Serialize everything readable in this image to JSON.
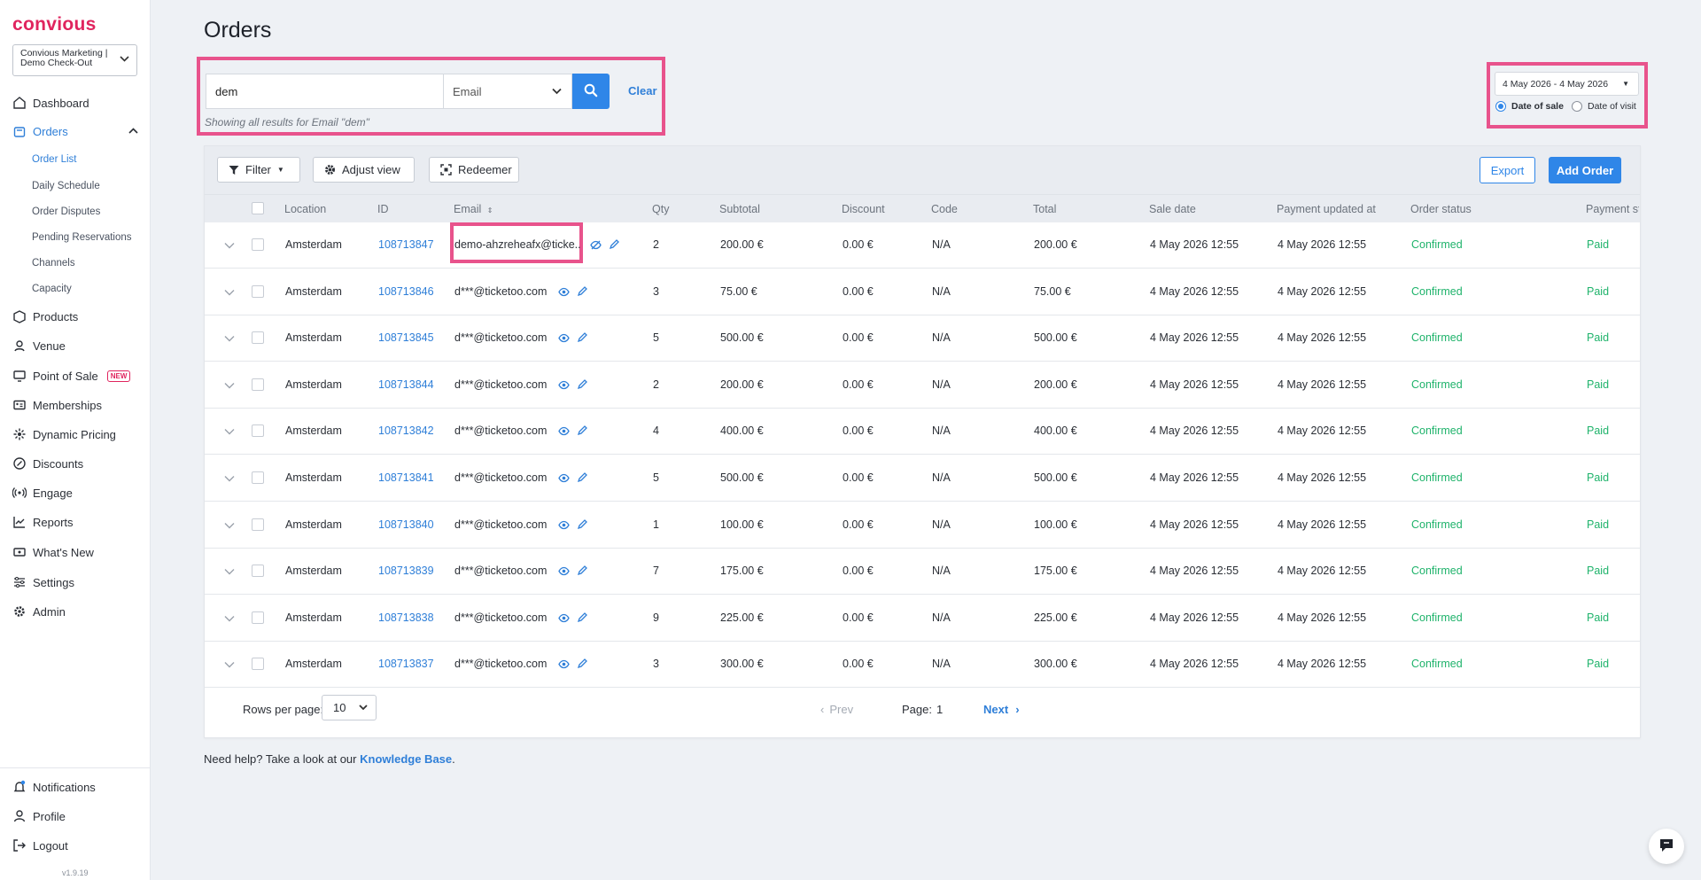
{
  "sidebar": {
    "logo": "convious",
    "account": {
      "line1": "Convious Marketing |",
      "line2": "Demo Check-Out"
    },
    "items": [
      {
        "label": "Dashboard",
        "icon": "home-icon"
      },
      {
        "label": "Orders",
        "icon": "bag-icon"
      },
      {
        "label": "Products",
        "icon": "box-icon"
      },
      {
        "label": "Venue",
        "icon": "venue-icon"
      },
      {
        "label": "Point of Sale",
        "icon": "monitor-icon",
        "badge": "NEW"
      },
      {
        "label": "Memberships",
        "icon": "id-card-icon"
      },
      {
        "label": "Dynamic Pricing",
        "icon": "pricing-icon"
      },
      {
        "label": "Discounts",
        "icon": "discount-icon"
      },
      {
        "label": "Engage",
        "icon": "broadcast-icon"
      },
      {
        "label": "Reports",
        "icon": "chart-icon"
      },
      {
        "label": "What's New",
        "icon": "ticket-icon"
      },
      {
        "label": "Settings",
        "icon": "sliders-icon"
      },
      {
        "label": "Admin",
        "icon": "gear-icon"
      }
    ],
    "order_sub": [
      "Order List",
      "Daily Schedule",
      "Order Disputes",
      "Pending Reservations",
      "Channels",
      "Capacity"
    ],
    "bottom": [
      {
        "label": "Notifications",
        "icon": "bell-icon"
      },
      {
        "label": "Profile",
        "icon": "user-icon"
      },
      {
        "label": "Logout",
        "icon": "logout-icon"
      }
    ],
    "version": "v1.9.19"
  },
  "page": {
    "title": "Orders"
  },
  "search": {
    "value": "dem",
    "type": "Email",
    "clear": "Clear",
    "hint": "Showing all results for Email \"dem\""
  },
  "date": {
    "range": "4 May 2026 - 4 May 2026",
    "option_sale": "Date of sale",
    "option_visit": "Date of visit",
    "selected": "sale"
  },
  "toolbar": {
    "filter": "Filter",
    "adjust": "Adjust view",
    "redeemer": "Redeemer",
    "export": "Export",
    "add": "Add Order"
  },
  "table": {
    "headers": [
      "Location",
      "ID",
      "Email",
      "Qty",
      "Subtotal",
      "Discount",
      "Code",
      "Total",
      "Sale date",
      "Payment updated at",
      "Order status",
      "Payment st"
    ],
    "rows": [
      {
        "location": "Amsterdam",
        "id": "108713847",
        "email": "demo-ahzreheafx@ticke...",
        "qty": "2",
        "subtotal": "200.00 €",
        "discount": "0.00 €",
        "code": "N/A",
        "total": "200.00 €",
        "sale_date": "4 May 2026 12:55",
        "payment_updated": "4 May 2026 12:55",
        "status": "Confirmed",
        "payment": "Paid"
      },
      {
        "location": "Amsterdam",
        "id": "108713846",
        "email": "d***@ticketoo.com",
        "qty": "3",
        "subtotal": "75.00 €",
        "discount": "0.00 €",
        "code": "N/A",
        "total": "75.00 €",
        "sale_date": "4 May 2026 12:55",
        "payment_updated": "4 May 2026 12:55",
        "status": "Confirmed",
        "payment": "Paid"
      },
      {
        "location": "Amsterdam",
        "id": "108713845",
        "email": "d***@ticketoo.com",
        "qty": "5",
        "subtotal": "500.00 €",
        "discount": "0.00 €",
        "code": "N/A",
        "total": "500.00 €",
        "sale_date": "4 May 2026 12:55",
        "payment_updated": "4 May 2026 12:55",
        "status": "Confirmed",
        "payment": "Paid"
      },
      {
        "location": "Amsterdam",
        "id": "108713844",
        "email": "d***@ticketoo.com",
        "qty": "2",
        "subtotal": "200.00 €",
        "discount": "0.00 €",
        "code": "N/A",
        "total": "200.00 €",
        "sale_date": "4 May 2026 12:55",
        "payment_updated": "4 May 2026 12:55",
        "status": "Confirmed",
        "payment": "Paid"
      },
      {
        "location": "Amsterdam",
        "id": "108713842",
        "email": "d***@ticketoo.com",
        "qty": "4",
        "subtotal": "400.00 €",
        "discount": "0.00 €",
        "code": "N/A",
        "total": "400.00 €",
        "sale_date": "4 May 2026 12:55",
        "payment_updated": "4 May 2026 12:55",
        "status": "Confirmed",
        "payment": "Paid"
      },
      {
        "location": "Amsterdam",
        "id": "108713841",
        "email": "d***@ticketoo.com",
        "qty": "5",
        "subtotal": "500.00 €",
        "discount": "0.00 €",
        "code": "N/A",
        "total": "500.00 €",
        "sale_date": "4 May 2026 12:55",
        "payment_updated": "4 May 2026 12:55",
        "status": "Confirmed",
        "payment": "Paid"
      },
      {
        "location": "Amsterdam",
        "id": "108713840",
        "email": "d***@ticketoo.com",
        "qty": "1",
        "subtotal": "100.00 €",
        "discount": "0.00 €",
        "code": "N/A",
        "total": "100.00 €",
        "sale_date": "4 May 2026 12:55",
        "payment_updated": "4 May 2026 12:55",
        "status": "Confirmed",
        "payment": "Paid"
      },
      {
        "location": "Amsterdam",
        "id": "108713839",
        "email": "d***@ticketoo.com",
        "qty": "7",
        "subtotal": "175.00 €",
        "discount": "0.00 €",
        "code": "N/A",
        "total": "175.00 €",
        "sale_date": "4 May 2026 12:55",
        "payment_updated": "4 May 2026 12:55",
        "status": "Confirmed",
        "payment": "Paid"
      },
      {
        "location": "Amsterdam",
        "id": "108713838",
        "email": "d***@ticketoo.com",
        "qty": "9",
        "subtotal": "225.00 €",
        "discount": "0.00 €",
        "code": "N/A",
        "total": "225.00 €",
        "sale_date": "4 May 2026 12:55",
        "payment_updated": "4 May 2026 12:55",
        "status": "Confirmed",
        "payment": "Paid"
      },
      {
        "location": "Amsterdam",
        "id": "108713837",
        "email": "d***@ticketoo.com",
        "qty": "3",
        "subtotal": "300.00 €",
        "discount": "0.00 €",
        "code": "N/A",
        "total": "300.00 €",
        "sale_date": "4 May 2026 12:55",
        "payment_updated": "4 May 2026 12:55",
        "status": "Confirmed",
        "payment": "Paid"
      }
    ]
  },
  "pagination": {
    "rows_label": "Rows per page:",
    "rows_value": "10",
    "prev": "Prev",
    "page_label": "Page:",
    "page": "1",
    "next": "Next"
  },
  "help": {
    "text": "Need help? Take a look at our ",
    "link": "Knowledge Base",
    "suffix": "."
  },
  "colors": {
    "brand": "#e0245e",
    "accent": "#2f86e8",
    "highlight": "#e8538c",
    "success": "#1fb36b"
  }
}
